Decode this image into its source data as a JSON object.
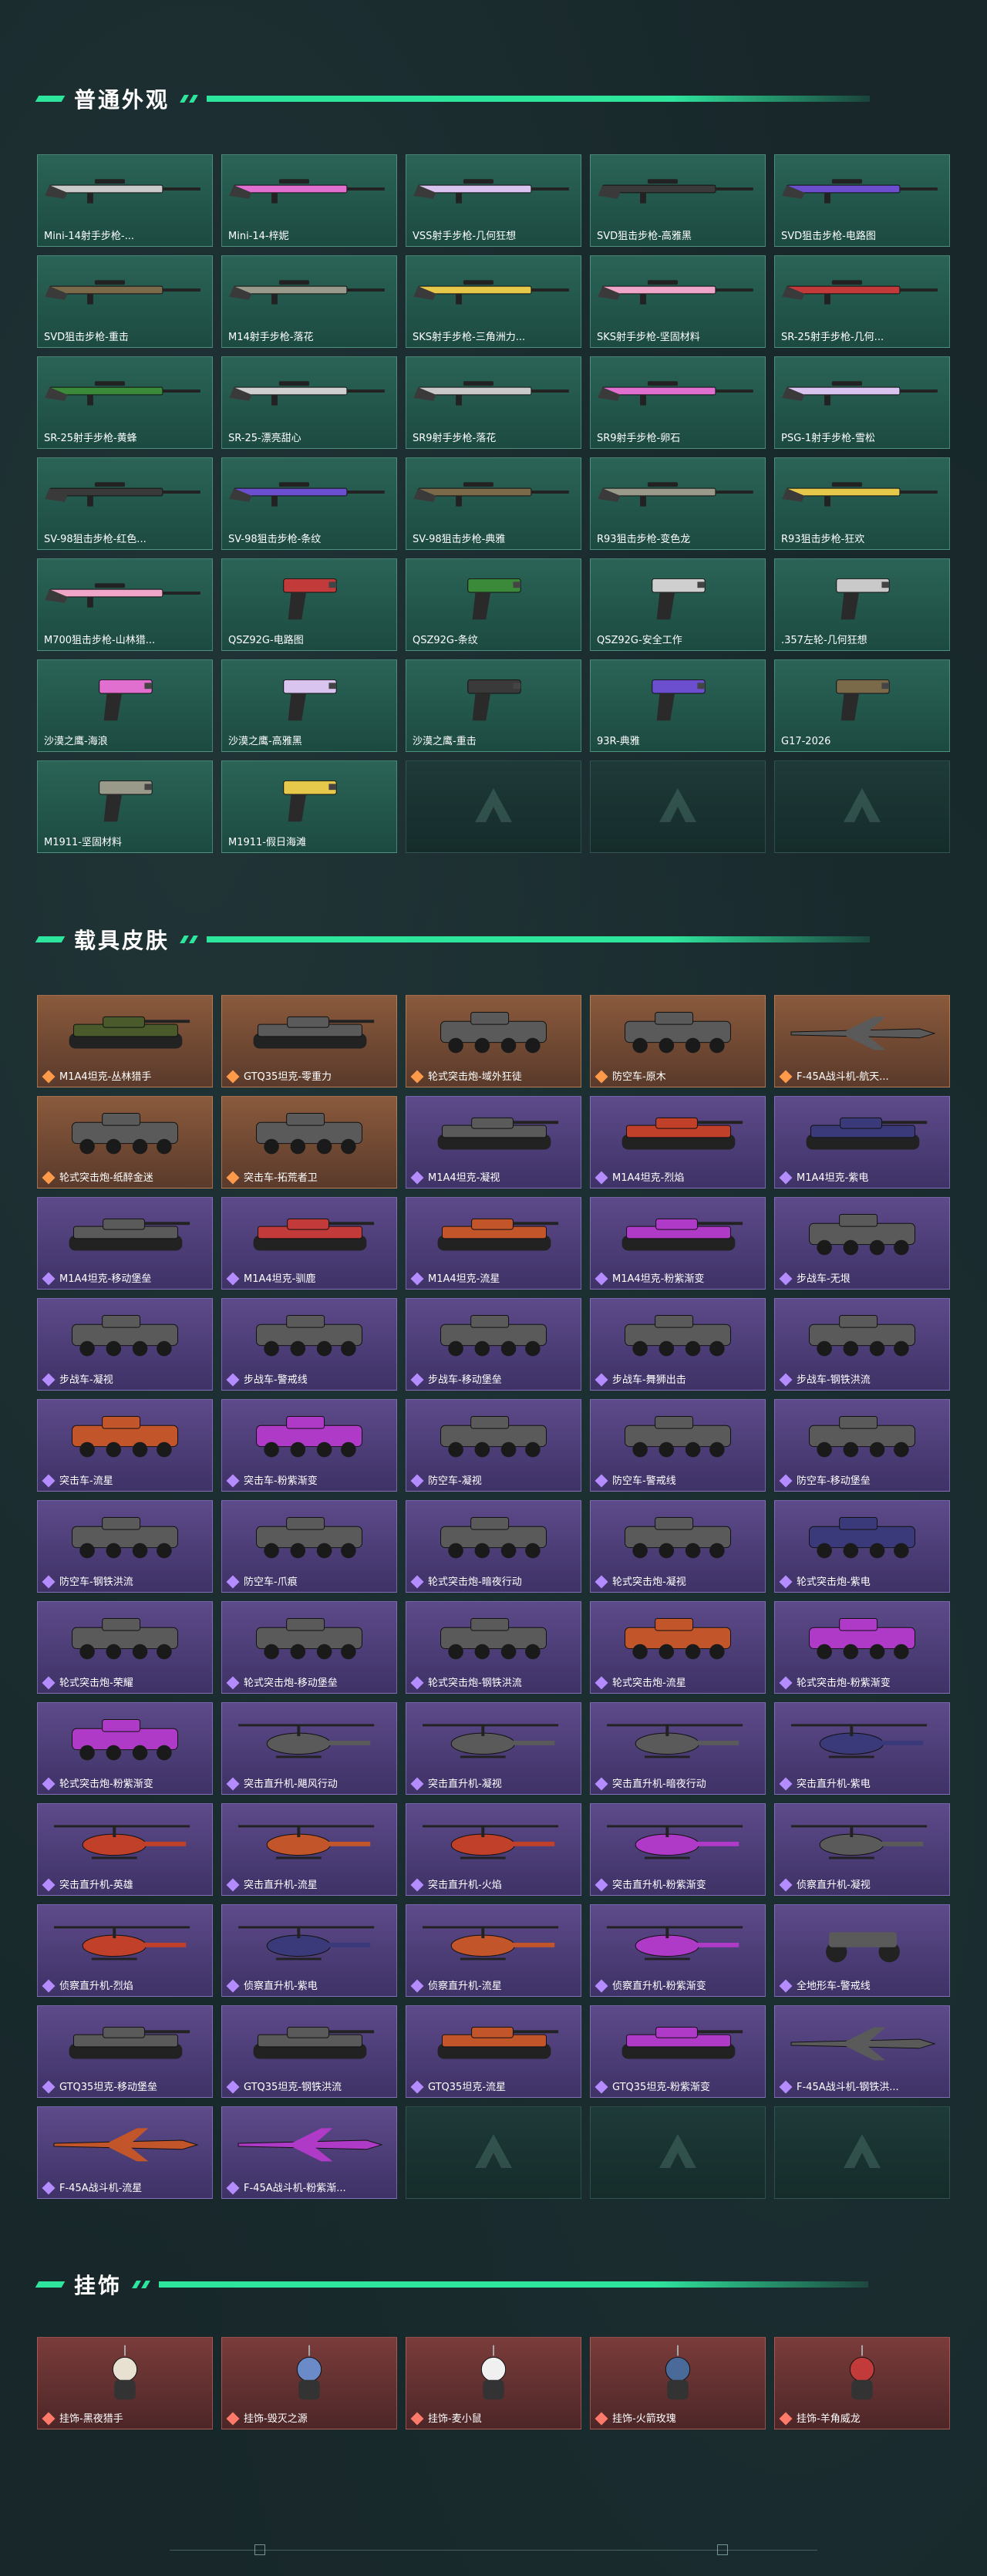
{
  "sections": {
    "weapons": {
      "title": "普通外观",
      "items": [
        {
          "label": "Mini-14射手步枪-..."
        },
        {
          "label": "Mini-14-梓妮"
        },
        {
          "label": "VSS射手步枪-几何狂想"
        },
        {
          "label": "SVD狙击步枪-高雅黑"
        },
        {
          "label": "SVD狙击步枪-电路图"
        },
        {
          "label": "SVD狙击步枪-重击"
        },
        {
          "label": "M14射手步枪-落花"
        },
        {
          "label": "SKS射手步枪-三角洲力..."
        },
        {
          "label": "SKS射手步枪-坚固材料"
        },
        {
          "label": "SR-25射手步枪-几何..."
        },
        {
          "label": "SR-25射手步枪-黄蜂"
        },
        {
          "label": "SR-25-漂亮甜心"
        },
        {
          "label": "SR9射手步枪-落花"
        },
        {
          "label": "SR9射手步枪-卵石"
        },
        {
          "label": "PSG-1射手步枪-雪松"
        },
        {
          "label": "SV-98狙击步枪-红色..."
        },
        {
          "label": "SV-98狙击步枪-条纹"
        },
        {
          "label": "SV-98狙击步枪-典雅"
        },
        {
          "label": "R93狙击步枪-变色龙"
        },
        {
          "label": "R93狙击步枪-狂欢"
        },
        {
          "label": "M700狙击步枪-山林猎..."
        },
        {
          "label": "QSZ92G-电路图"
        },
        {
          "label": "QSZ92G-条纹"
        },
        {
          "label": "QSZ92G-安全工作"
        },
        {
          "label": ".357左轮-几何狂想"
        },
        {
          "label": "沙漠之鹰-海浪"
        },
        {
          "label": "沙漠之鹰-高雅黑"
        },
        {
          "label": "沙漠之鹰-重击"
        },
        {
          "label": "93R-典雅"
        },
        {
          "label": "G17-2026"
        },
        {
          "label": "M1911-坚固材料"
        },
        {
          "label": "M1911-假日海滩"
        },
        {
          "label": ""
        },
        {
          "label": ""
        },
        {
          "label": ""
        }
      ]
    },
    "vehicles": {
      "title": "载具皮肤",
      "items": [
        {
          "label": "M1A4坦克-丛林猎手",
          "tone": "orange"
        },
        {
          "label": "GTQ35坦克-零重力",
          "tone": "orange"
        },
        {
          "label": "轮式突击炮-域外狂徒",
          "tone": "orange"
        },
        {
          "label": "防空车-原木",
          "tone": "orange"
        },
        {
          "label": "F-45A战斗机-航天...",
          "tone": "orange"
        },
        {
          "label": "轮式突击炮-纸醉金迷",
          "tone": "orange"
        },
        {
          "label": "突击车-拓荒者卫",
          "tone": "orange"
        },
        {
          "label": "M1A4坦克-凝视",
          "tone": "purple"
        },
        {
          "label": "M1A4坦克-烈焰",
          "tone": "purple"
        },
        {
          "label": "M1A4坦克-紫电",
          "tone": "purple"
        },
        {
          "label": "M1A4坦克-移动堡垒",
          "tone": "purple"
        },
        {
          "label": "M1A4坦克-驯鹿",
          "tone": "purple"
        },
        {
          "label": "M1A4坦克-流星",
          "tone": "purple"
        },
        {
          "label": "M1A4坦克-粉紫渐变",
          "tone": "purple"
        },
        {
          "label": "步战车-无垠",
          "tone": "purple"
        },
        {
          "label": "步战车-凝视",
          "tone": "purple"
        },
        {
          "label": "步战车-警戒线",
          "tone": "purple"
        },
        {
          "label": "步战车-移动堡垒",
          "tone": "purple"
        },
        {
          "label": "步战车-舞狮出击",
          "tone": "purple"
        },
        {
          "label": "步战车-钢铁洪流",
          "tone": "purple"
        },
        {
          "label": "突击车-流星",
          "tone": "purple"
        },
        {
          "label": "突击车-粉紫渐变",
          "tone": "purple"
        },
        {
          "label": "防空车-凝视",
          "tone": "purple"
        },
        {
          "label": "防空车-警戒线",
          "tone": "purple"
        },
        {
          "label": "防空车-移动堡垒",
          "tone": "purple"
        },
        {
          "label": "防空车-钢铁洪流",
          "tone": "purple"
        },
        {
          "label": "防空车-爪痕",
          "tone": "purple"
        },
        {
          "label": "轮式突击炮-暗夜行动",
          "tone": "purple"
        },
        {
          "label": "轮式突击炮-凝视",
          "tone": "purple"
        },
        {
          "label": "轮式突击炮-紫电",
          "tone": "purple"
        },
        {
          "label": "轮式突击炮-荣耀",
          "tone": "purple"
        },
        {
          "label": "轮式突击炮-移动堡垒",
          "tone": "purple"
        },
        {
          "label": "轮式突击炮-钢铁洪流",
          "tone": "purple"
        },
        {
          "label": "轮式突击炮-流星",
          "tone": "purple"
        },
        {
          "label": "轮式突击炮-粉紫渐变",
          "tone": "purple"
        },
        {
          "label": "轮式突击炮-粉紫渐变",
          "tone": "purple"
        },
        {
          "label": "突击直升机-飓风行动",
          "tone": "purple"
        },
        {
          "label": "突击直升机-凝视",
          "tone": "purple"
        },
        {
          "label": "突击直升机-暗夜行动",
          "tone": "purple"
        },
        {
          "label": "突击直升机-紫电",
          "tone": "purple"
        },
        {
          "label": "突击直升机-英雄",
          "tone": "purple"
        },
        {
          "label": "突击直升机-流星",
          "tone": "purple"
        },
        {
          "label": "突击直升机-火焰",
          "tone": "purple"
        },
        {
          "label": "突击直升机-粉紫渐变",
          "tone": "purple"
        },
        {
          "label": "侦察直升机-凝视",
          "tone": "purple"
        },
        {
          "label": "侦察直升机-烈焰",
          "tone": "purple"
        },
        {
          "label": "侦察直升机-紫电",
          "tone": "purple"
        },
        {
          "label": "侦察直升机-流星",
          "tone": "purple"
        },
        {
          "label": "侦察直升机-粉紫渐变",
          "tone": "purple"
        },
        {
          "label": "全地形车-警戒线",
          "tone": "purple"
        },
        {
          "label": "GTQ35坦克-移动堡垒",
          "tone": "purple"
        },
        {
          "label": "GTQ35坦克-钢铁洪流",
          "tone": "purple"
        },
        {
          "label": "GTQ35坦克-流星",
          "tone": "purple"
        },
        {
          "label": "GTQ35坦克-粉紫渐变",
          "tone": "purple"
        },
        {
          "label": "F-45A战斗机-钢铁洪...",
          "tone": "purple"
        },
        {
          "label": "F-45A战斗机-流星",
          "tone": "purple"
        },
        {
          "label": "F-45A战斗机-粉紫渐...",
          "tone": "purple"
        },
        {
          "label": "",
          "tone": "empty"
        },
        {
          "label": "",
          "tone": "empty"
        },
        {
          "label": "",
          "tone": "empty"
        }
      ]
    },
    "charms": {
      "title": "挂饰",
      "items": [
        {
          "label": "挂饰-黑夜猎手",
          "tone": "red"
        },
        {
          "label": "挂饰-毁灭之源",
          "tone": "red"
        },
        {
          "label": "挂饰-麦小鼠",
          "tone": "red"
        },
        {
          "label": "挂饰-火箭玫瑰",
          "tone": "red"
        },
        {
          "label": "挂饰-羊角威龙",
          "tone": "red"
        }
      ]
    }
  },
  "colors": {
    "accent": "#2ee59d",
    "background": "#17272a"
  }
}
